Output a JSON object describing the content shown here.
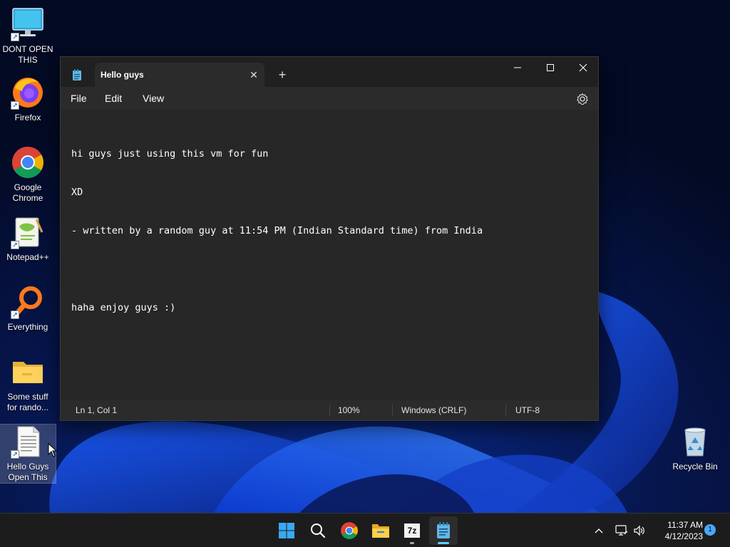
{
  "desktop": {
    "icons": [
      {
        "label": "DONT OPEN THIS",
        "icon": "monitor-icon"
      },
      {
        "label": "Firefox",
        "icon": "firefox-icon"
      },
      {
        "label": "Google Chrome",
        "icon": "chrome-icon"
      },
      {
        "label": "Notepad++",
        "icon": "notepadpp-icon"
      },
      {
        "label": "Everything",
        "icon": "search-icon"
      },
      {
        "label": "Some stuff for rando...",
        "icon": "folder-icon"
      },
      {
        "label": "Hello Guys Open This",
        "icon": "text-file-icon"
      },
      {
        "label": "Recycle Bin",
        "icon": "recycle-bin-icon"
      }
    ]
  },
  "notepad": {
    "tab_title": "Hello guys",
    "new_tab": "+",
    "menu": [
      "File",
      "Edit",
      "View"
    ],
    "content_lines": [
      "hi guys just using this vm for fun",
      "XD",
      "- written by a random guy at 11:54 PM (Indian Standard time) from India",
      "",
      "haha enjoy guys :)"
    ],
    "status": {
      "position": "Ln 1, Col 1",
      "zoom": "100%",
      "line_ending": "Windows (CRLF)",
      "encoding": "UTF-8"
    }
  },
  "taskbar": {
    "apps": [
      "start-icon",
      "search-icon",
      "chrome-icon",
      "file-explorer-icon",
      "7zip-icon",
      "notepad-icon"
    ],
    "app_7zip_label": "7z",
    "time": "11:37 AM",
    "date": "4/12/2023",
    "notification_count": "1"
  },
  "colors": {
    "accent": "#60cdff",
    "window_bg": "#202020",
    "editor_bg": "#272727",
    "taskbar_bg": "#1c1c1c"
  }
}
